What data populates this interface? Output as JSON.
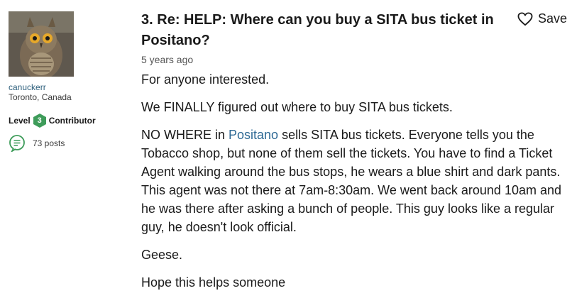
{
  "author": {
    "name": "canuckerr",
    "location": "Toronto, Canada",
    "level_label": "Level",
    "level_number": "3",
    "level_title": "Contributor",
    "posts_count": "73 posts",
    "avatar_icon": "owl-avatar"
  },
  "post": {
    "number": "3.",
    "title": "Re: HELP: Where can you buy a SITA bus ticket in Positano?",
    "save_label": "Save",
    "date": "5 years ago",
    "paragraphs": {
      "p1": "For anyone interested.",
      "p2": "We FINALLY figured out where to buy SITA bus tickets.",
      "p3_before": "NO WHERE in ",
      "p3_link": "Positano",
      "p3_after": " sells SITA bus tickets. Everyone tells you the Tobacco shop, but none of them sell the tickets. You have to find a Ticket Agent walking around the bus stops, he wears a blue shirt and dark pants. This agent was not there at 7am-8:30am. We went back around 10am and he was there after asking a bunch of people. This guy looks like a regular guy, he doesn't look official.",
      "p4": "Geese.",
      "p5": "Hope this helps someone"
    }
  },
  "colors": {
    "link": "#2f6a95",
    "badge": "#3e9c5a",
    "posts_icon": "#3e9c5a"
  }
}
